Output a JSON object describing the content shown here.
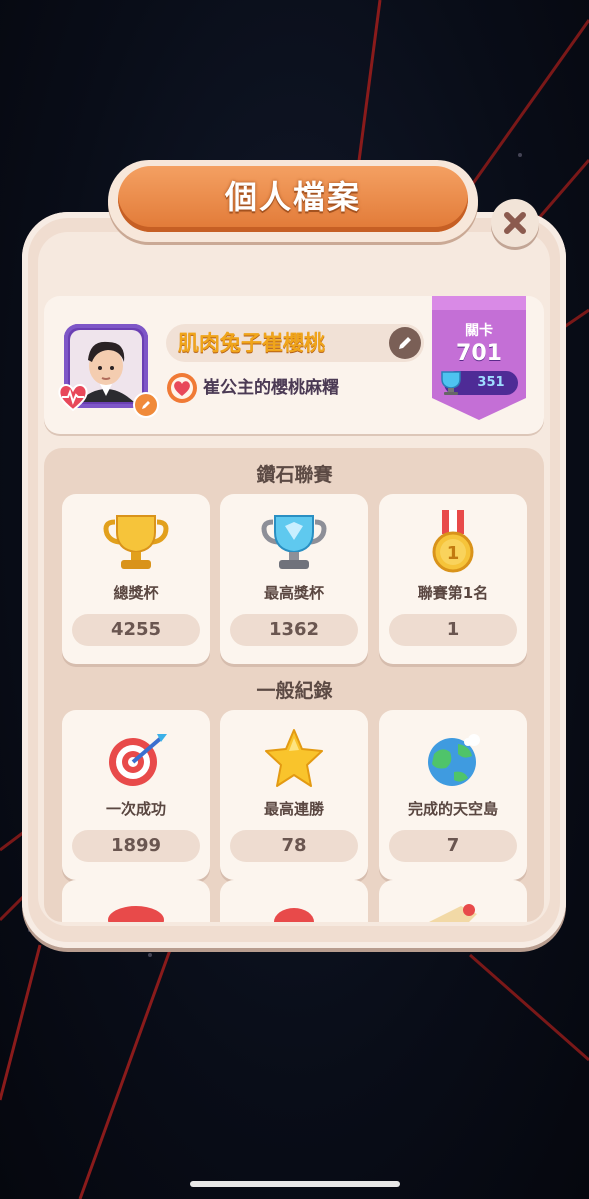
{
  "header": {
    "title": "個人檔案"
  },
  "profile": {
    "player_name": "肌肉兔子崔櫻桃",
    "team_name": "崔公主的櫻桃麻糬",
    "level_label": "關卡",
    "level_value": "701",
    "trophy_count": "351"
  },
  "diamond_league": {
    "title": "鑽石聯賽",
    "stats": [
      {
        "label": "總獎杯",
        "value": "4255",
        "icon": "gold-trophy-icon"
      },
      {
        "label": "最高獎杯",
        "value": "1362",
        "icon": "diamond-trophy-icon"
      },
      {
        "label": "聯賽第1名",
        "value": "1",
        "icon": "first-place-medal-icon"
      }
    ]
  },
  "general_records": {
    "title": "一般紀錄",
    "stats": [
      {
        "label": "一次成功",
        "value": "1899",
        "icon": "bullseye-icon"
      },
      {
        "label": "最高連勝",
        "value": "78",
        "icon": "star-icon"
      },
      {
        "label": "完成的天空島",
        "value": "7",
        "icon": "planet-icon"
      }
    ]
  },
  "colors": {
    "title_plate": "#e17936",
    "panel": "#f0ddd0",
    "level_banner": "#c46fd6",
    "name_text": "#f0a51b"
  }
}
